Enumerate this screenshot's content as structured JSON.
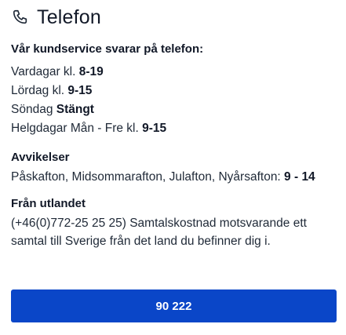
{
  "header": {
    "icon": "phone-icon",
    "title": "Telefon"
  },
  "hours": {
    "heading": "Vår kundservice svarar på telefon:",
    "rows": [
      {
        "label": "Vardagar kl. ",
        "value": "8-19"
      },
      {
        "label": "Lördag kl. ",
        "value": "9-15"
      },
      {
        "label": "Söndag ",
        "value": "Stängt"
      },
      {
        "label": "Helgdagar Mån - Fre kl. ",
        "value": "9-15"
      }
    ]
  },
  "exceptions": {
    "heading": "Avvikelser",
    "text": "Påskafton, Midsommarafton, Julafton, Nyårsafton: ",
    "value": "9 - 14"
  },
  "abroad": {
    "heading": "Från utlandet",
    "line1": "(+46(0)772-25 25 25) Samtalskostnad motsvarande ett",
    "line2": "samtal till Sverige från det land du befinner dig i."
  },
  "call_button": {
    "label": "90 222",
    "color": "#0a46c8"
  }
}
